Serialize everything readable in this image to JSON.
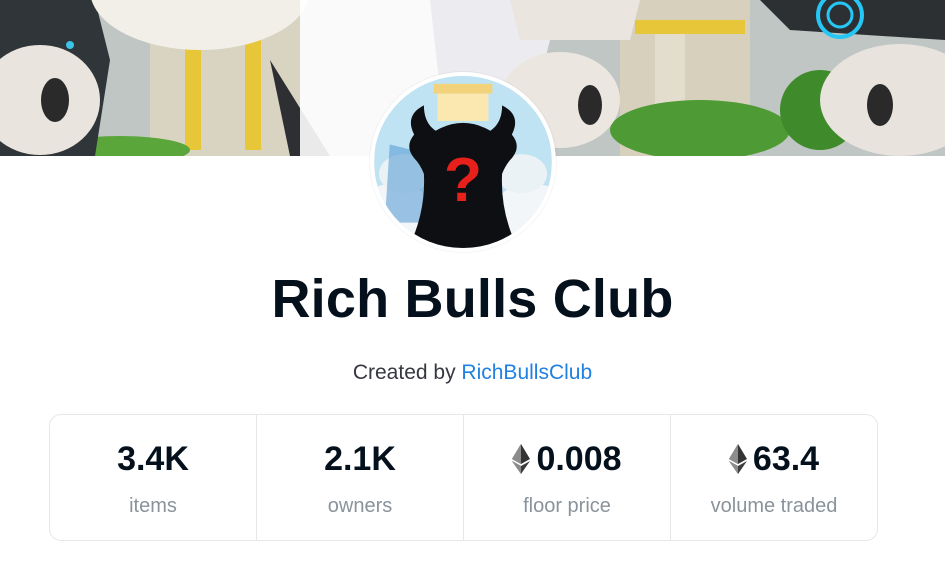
{
  "collection": {
    "name": "Rich Bulls Club",
    "created_by_prefix": "Created by",
    "creator": "RichBullsClub"
  },
  "stats": [
    {
      "value": "3.4K",
      "label": "items",
      "currency_icon": null
    },
    {
      "value": "2.1K",
      "label": "owners",
      "currency_icon": null
    },
    {
      "value": "0.008",
      "label": "floor price",
      "currency_icon": "ethereum-icon"
    },
    {
      "value": "63.4",
      "label": "volume traded",
      "currency_icon": "ethereum-icon"
    }
  ],
  "colors": {
    "title": "#04111d",
    "link": "#2081e2",
    "muted": "#8a939b",
    "border": "#e5e8eb"
  }
}
